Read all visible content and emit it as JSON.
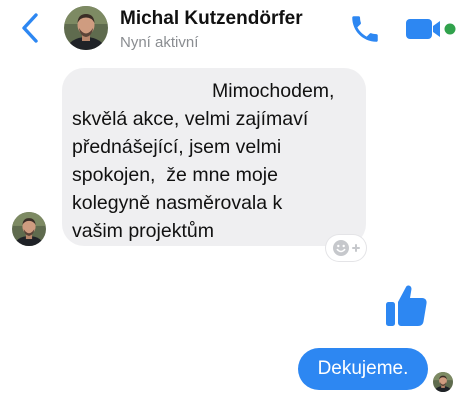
{
  "header": {
    "contact_name": "Michal Kutzendörfer",
    "status": "Nyní aktivní",
    "back_icon": "chevron-left-icon",
    "call_icon": "phone-icon",
    "video_icon": "video-camera-icon",
    "active_indicator_color": "#31a24c"
  },
  "conversation": {
    "incoming_message": {
      "lines": [
        "Mimochodem,",
        "skvělá akce, velmi zajímaví",
        "přednášející, jsem velmi",
        "spokojen,  že mne moje",
        "kolegyně nasměrovala k",
        "vašim projektům"
      ],
      "reaction_icon": "add-reaction-smiley-icon"
    },
    "sent_like_icon": "thumbs-up-icon",
    "outgoing_message": {
      "text": "Dekujeme."
    }
  },
  "colors": {
    "accent": "#2d87f2",
    "incoming_bubble": "#efeff1",
    "status_text": "#8a8d91"
  }
}
